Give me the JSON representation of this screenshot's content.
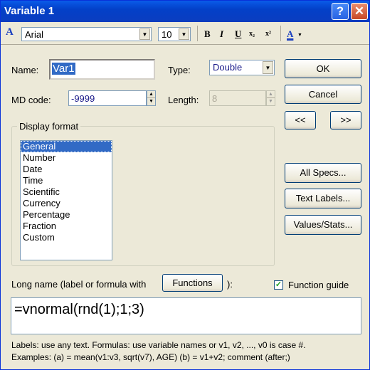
{
  "window": {
    "title": "Variable 1",
    "help_glyph": "?",
    "close_glyph": "✕"
  },
  "toolbar": {
    "font_icon": "A",
    "font_name": "Arial",
    "font_size": "10",
    "bold": "B",
    "italic": "I",
    "underline": "U",
    "subscript": "x₂",
    "superscript": "x²",
    "color_icon": "A"
  },
  "fields": {
    "name_label": "Name:",
    "name_value": "Var1",
    "type_label": "Type:",
    "type_value": "Double",
    "md_label": "MD code:",
    "md_value": "-9999",
    "length_label": "Length:",
    "length_value": "8"
  },
  "buttons": {
    "ok": "OK",
    "cancel": "Cancel",
    "prev": "<<",
    "next": ">>",
    "all_specs": "All Specs...",
    "text_labels": "Text Labels...",
    "values_stats": "Values/Stats...",
    "functions": "Functions"
  },
  "display_format": {
    "legend": "Display format",
    "items": [
      "General",
      "Number",
      "Date",
      "Time",
      "Scientific",
      "Currency",
      "Percentage",
      "Fraction",
      "Custom"
    ],
    "selected": "General"
  },
  "long_name": {
    "label_before": "Long name (label or formula with",
    "label_after": "):",
    "function_guide_label": "Function guide",
    "function_guide_checked": true,
    "formula": "=vnormal(rnd(1);1;3)"
  },
  "hints": {
    "line1": "Labels: use any text.  Formulas: use variable names or v1, v2, ..., v0 is case #.",
    "line2": "Examples:   (a) = mean(v1:v3, sqrt(v7), AGE)   (b) = v1+v2; comment (after;)"
  }
}
